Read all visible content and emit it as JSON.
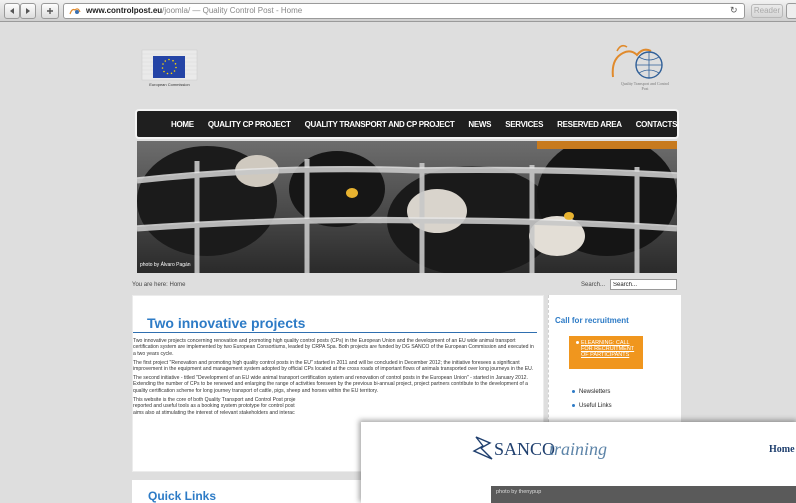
{
  "browser": {
    "back_icon": "back-arrow-icon",
    "forward_icon": "forward-arrow-icon",
    "add_icon": "plus-icon",
    "url_host": "www.controlpost.eu",
    "url_path": "/joomla/",
    "page_title": "— Quality Control Post - Home",
    "reader_label": "Reader"
  },
  "header": {
    "eu_logo_text": "European Commission",
    "qt_logo_text": "Quality Transport and Control Post"
  },
  "nav": {
    "items": [
      "HOME",
      "QUALITY CP PROJECT",
      "QUALITY TRANSPORT AND CP PROJECT",
      "NEWS",
      "SERVICES",
      "RESERVED AREA",
      "CONTACTS"
    ]
  },
  "hero": {
    "credit": "photo by Álvaro Pagán"
  },
  "breadcrumb": {
    "label": "You are here:",
    "value": "Home"
  },
  "search": {
    "label": "Search...",
    "placeholder": "Search..."
  },
  "article": {
    "title": "Two innovative projects",
    "paragraphs": [
      "Two innovative projects concerning renovation and promoting high quality control posts (CPs) in the European Union and the development of an EU wide animal transport certification system are implemented by two European Consortiums, leaded by CRPA Spa. Both projects are funded by DG SANCO of the European Commission and executed in a two years cycle.",
      "The first project \"Renovation and promoting high quality control posts in the EU\" started in 2011 and will be concluded in December 2012; the initiative foresees a significant improvement in the equipment and management system adopted by official CPs located at the cross roads of important flows of animals transported over long journeys in the EU.",
      "The second initiative - titled \"Development of an EU wide animal transport certification system and renovation of control posts in the European Union\" - started in January 2012. Extending the number of CPs to be renewed and enlarging the range of activities foreseen by the previous bi-annual project, project partners contribute to the development of a quality certification scheme for long journey transport of cattle, pigs, sheep and horses within the EU territory.",
      "This website is the core of both Quality Transport and Control Post proje",
      "reported and useful tools as a booking system prototype for control post",
      "aims also at stimulating the interest of relevant stakeholders and interac"
    ]
  },
  "sidebar": {
    "title": "Call for recruitment",
    "highlight_link": "ELEARNING: CALL FOR RECRUITMENT OF PARTICIPANTS",
    "links": [
      "Newsletters",
      "Useful Links"
    ]
  },
  "quick_links": {
    "title": "Quick Links"
  },
  "overlay": {
    "brand_bold": "SANCO",
    "brand_italic": "training",
    "nav_label": "Home",
    "photo_credit": "photo by thenypup"
  }
}
